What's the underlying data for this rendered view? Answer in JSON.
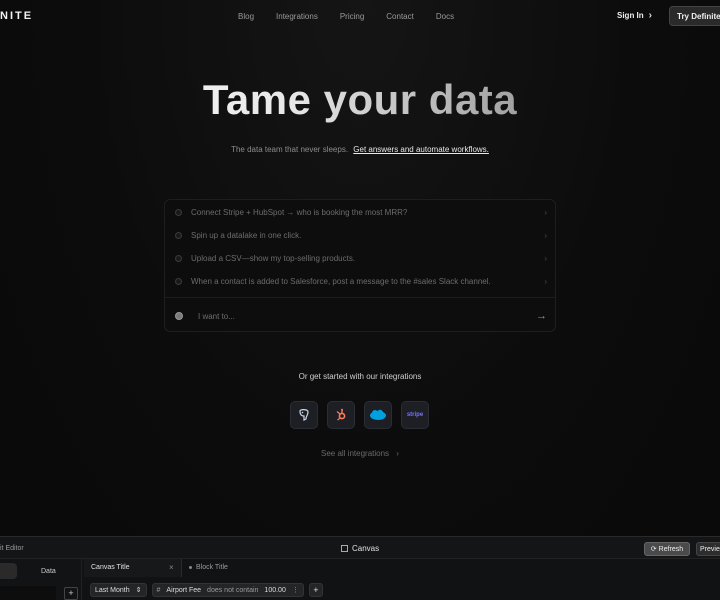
{
  "nav": {
    "logo": "NITE",
    "links": [
      "Blog",
      "Integrations",
      "Pricing",
      "Contact",
      "Docs"
    ],
    "sign_in": "Sign In",
    "cta": "Try Definite n"
  },
  "hero": {
    "title": "Tame your data",
    "subtitle": "The data team that never sleeps.",
    "subtitle_link": "Get answers and automate workflows."
  },
  "prompt": {
    "suggestions": [
      "Connect Stripe + HubSpot → who is booking the most MRR?",
      "Spin up a datalake in one click.",
      "Upload a CSV—show my top-selling products.",
      "When a contact is added to Salesforce, post a message to the #sales Slack channel."
    ],
    "placeholder": "I want to..."
  },
  "integrations": {
    "label": "Or get started with our integrations",
    "items": [
      {
        "icon": "postgres-icon",
        "color": "#336791"
      },
      {
        "icon": "hubspot-icon",
        "color": "#ff7a59"
      },
      {
        "icon": "salesforce-icon",
        "color": "#00a1e0"
      },
      {
        "icon": "stripe-icon",
        "color": "#635bff",
        "text": "stripe"
      }
    ],
    "see_all": "See all integrations"
  },
  "editor": {
    "left_label": "it Editor",
    "canvas_label": "Canvas",
    "refresh": "Refresh",
    "preview": "Previe",
    "side_tab": "Data",
    "tab_title": "Canvas Title",
    "block_title": "Block Title",
    "filters": {
      "period": "Last Month",
      "field": "Airport Fee",
      "operator": "does not contain",
      "value": "100.00"
    }
  }
}
